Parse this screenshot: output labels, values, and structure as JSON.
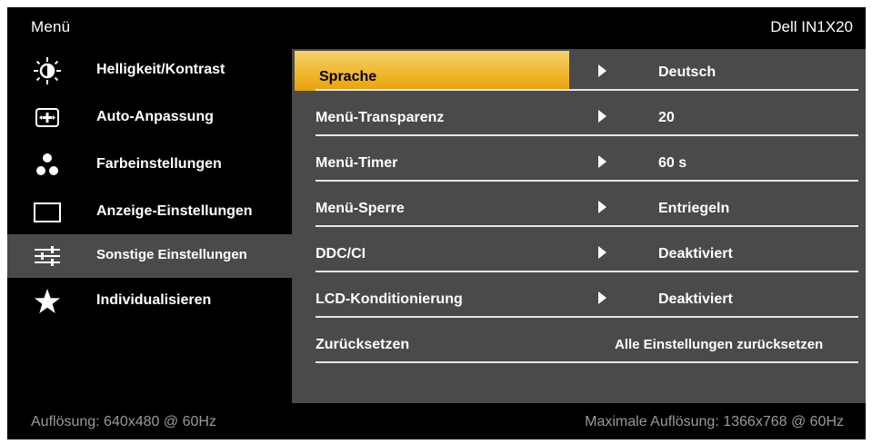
{
  "header": {
    "title": "Menü",
    "model": "Dell IN1X20"
  },
  "sidebar": {
    "items": [
      {
        "label": "Helligkeit/Kontrast",
        "icon": "brightness-icon"
      },
      {
        "label": "Auto-Anpassung",
        "icon": "auto-adjust-icon"
      },
      {
        "label": "Farbeinstellungen",
        "icon": "color-dots-icon"
      },
      {
        "label": "Anzeige-Einstellungen",
        "icon": "display-icon"
      },
      {
        "label": "Sonstige Einstellungen",
        "icon": "sliders-icon",
        "active": true
      },
      {
        "label": "Individualisieren",
        "icon": "star-icon"
      }
    ]
  },
  "settings": {
    "rows": [
      {
        "label": "Sprache",
        "value": "Deutsch",
        "selected": true
      },
      {
        "label": "Menü-Transparenz",
        "value": "20"
      },
      {
        "label": "Menü-Timer",
        "value": "60 s"
      },
      {
        "label": "Menü-Sperre",
        "value": "Entriegeln"
      },
      {
        "label": "DDC/CI",
        "value": "Deaktiviert"
      },
      {
        "label": "LCD-Konditionierung",
        "value": "Deaktiviert"
      },
      {
        "label": "Zurücksetzen",
        "value": "Alle Einstellungen zurücksetzen"
      }
    ]
  },
  "footer": {
    "resolution": "Auflösung:  640x480 @ 60Hz",
    "max_resolution": "Maximale Auflösung: 1366x768 @ 60Hz"
  },
  "colors": {
    "background": "#000000",
    "panel": "#4a4a4a",
    "highlight": "#f1b72e",
    "footer_text": "#9a9a9a"
  }
}
